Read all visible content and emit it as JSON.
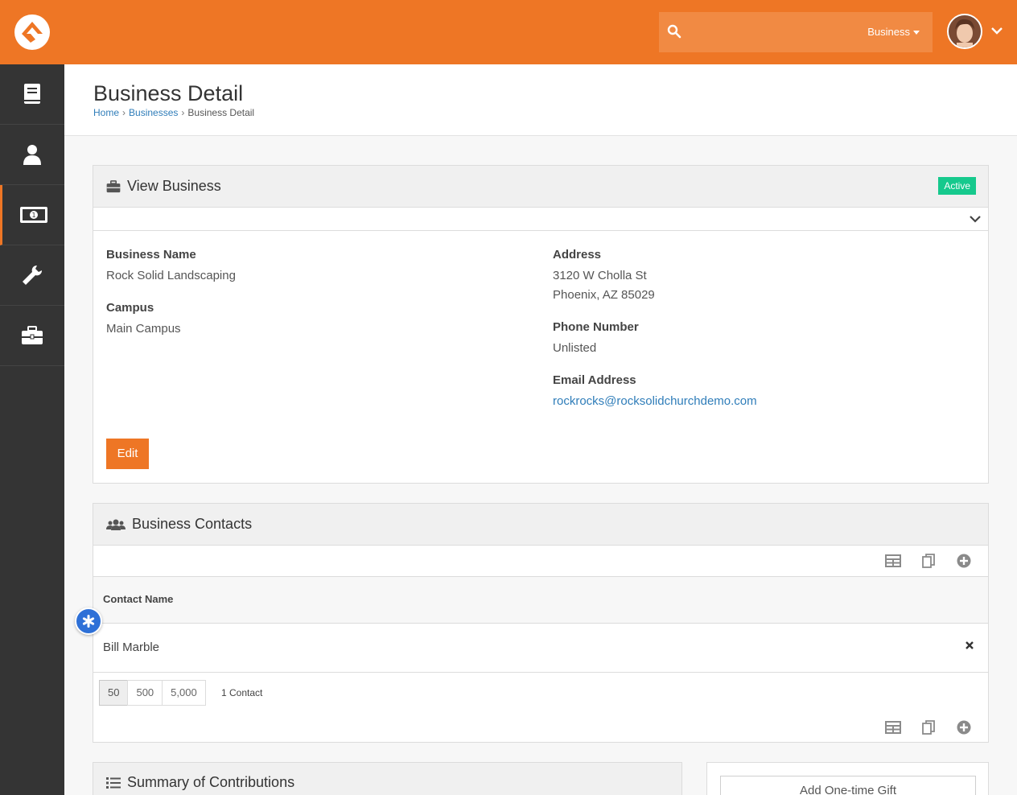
{
  "header": {
    "search_scope": "Business",
    "colors": {
      "brand": "#ee7625",
      "sidebar": "#343434",
      "link": "#2f7db9",
      "active_badge": "#16c98d",
      "fab": "#2e70d7"
    }
  },
  "sidebar": {
    "items": [
      {
        "icon": "book-icon"
      },
      {
        "icon": "user-icon"
      },
      {
        "icon": "money-icon",
        "active": true
      },
      {
        "icon": "wrench-icon"
      },
      {
        "icon": "briefcase-icon"
      }
    ]
  },
  "page": {
    "title": "Business Detail",
    "breadcrumb": [
      "Home",
      "Businesses",
      "Business Detail"
    ]
  },
  "view_business": {
    "title": "View Business",
    "status": "Active",
    "fields": {
      "business_name_label": "Business Name",
      "business_name": "Rock Solid Landscaping",
      "campus_label": "Campus",
      "campus": "Main Campus",
      "address_label": "Address",
      "address_line1": "3120 W Cholla St",
      "address_line2": "Phoenix, AZ 85029",
      "phone_label": "Phone Number",
      "phone": "Unlisted",
      "email_label": "Email Address",
      "email": "rockrocks@rocksolidchurchdemo.com"
    },
    "edit_label": "Edit"
  },
  "contacts": {
    "title": "Business Contacts",
    "column_header": "Contact Name",
    "rows": [
      {
        "name": "Bill Marble"
      }
    ],
    "page_sizes": [
      "50",
      "500",
      "5,000"
    ],
    "count_text": "1 Contact"
  },
  "contributions": {
    "title": "Summary of Contributions"
  },
  "gift": {
    "button_label": "Add One-time Gift"
  }
}
